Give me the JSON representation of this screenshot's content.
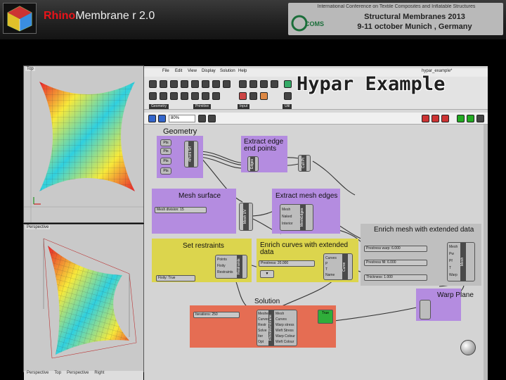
{
  "header": {
    "title_brand": "Rhino",
    "title_rest": "Membrane r 2.0",
    "conference_line0": "International Conference on Textile Composites and Inflatable Structures",
    "conference_line1": "Structural Membranes 2013",
    "conference_line2": "9-11 october Munich , Germany",
    "conference_logo_text": "COMS"
  },
  "slide_title": "Hypar Example",
  "rhino": {
    "top_viewport_label": "Top",
    "perspective_viewport_label": "Perspective",
    "status_tabs": [
      "Perspective",
      "Top",
      "Perspective",
      "Right"
    ]
  },
  "grasshopper": {
    "menu": [
      "File",
      "Edit",
      "View",
      "Display",
      "Solution",
      "Help"
    ],
    "file_name": "hypar_example*",
    "ribbon_tabs": [
      "Geometry",
      "Primitive",
      "Input",
      "Util"
    ],
    "zoom": "80%"
  },
  "groups": {
    "geometry": "Geometry",
    "extract_edge": "Extract edge end points",
    "mesh_surface": "Mesh surface",
    "extract_mesh_edges": "Extract mesh edges",
    "enrich_mesh": "Enrich mesh with extended data",
    "set_restraints": "Set restraints",
    "enrich_curves": "Enrich curves with extended data",
    "solution": "Solution",
    "warp_plane": "Warp Plane"
  },
  "components": {
    "pts": [
      "Pts",
      "Pts",
      "Pts",
      "Pts"
    ],
    "brep": "4Point Srf",
    "edges": "Edges",
    "cull": "Cull Pt",
    "mesh_ui": "Mesh UV",
    "mesh_edges": "MeshEdges",
    "enrich_mesh": "Mesh",
    "restraints": "Restraints",
    "enrich_curves": "Curve",
    "solver": "RhinoMembrane",
    "mesh_slider": "Mesh division: 15",
    "mesh_outputs": [
      "Mesh",
      "Naked",
      "Interior"
    ],
    "enrich_mesh_sliders": [
      "Prestress warp: 6.000",
      "Prestress fill: 6.000",
      "Thickness: 1.000"
    ],
    "enrich_mesh_inputs": [
      "Mesh",
      "Pw",
      "Pf",
      "T",
      "Warp"
    ],
    "restraint_inputs": [
      "Points",
      "Fixity",
      "Restraints"
    ],
    "restraint_slider": "Fixity: True",
    "curve_slider": "Prestress: 20.000",
    "curve_inputs": [
      "Curves",
      "P",
      "T",
      "Name"
    ],
    "solver_inputs": [
      "Meshes",
      "Curves",
      "Restr",
      "Solve",
      "Iter",
      "Opt"
    ],
    "solver_outputs": [
      "Mesh",
      "Curves",
      "Warp stress",
      "Weft Stress",
      "Warp Colour",
      "Weft Colour"
    ],
    "solver_slider": "Iterations: 250",
    "toggle_text": "True"
  }
}
